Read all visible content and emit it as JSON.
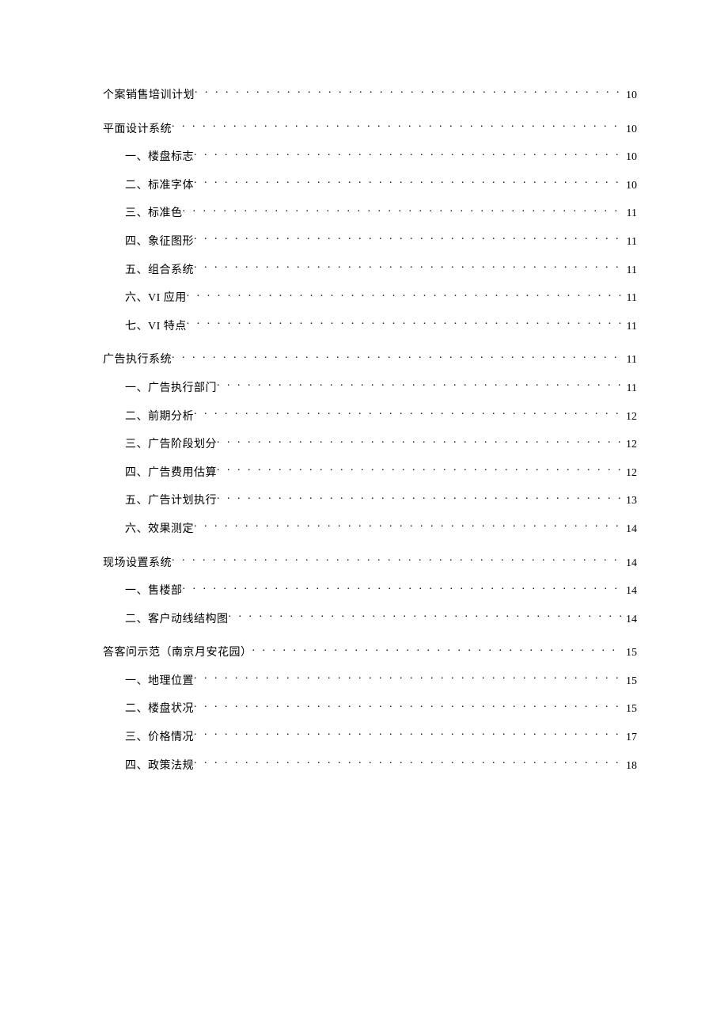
{
  "toc": [
    {
      "level": "section",
      "title": "个案销售培训计划",
      "page": "10"
    },
    {
      "level": "section",
      "title": "平面设计系统",
      "page": "10"
    },
    {
      "level": "sub",
      "title": "一、楼盘标志",
      "page": "10"
    },
    {
      "level": "sub",
      "title": "二、标准字体",
      "page": "10"
    },
    {
      "level": "sub",
      "title": "三、标准色",
      "page": "11"
    },
    {
      "level": "sub",
      "title": "四、象征图形",
      "page": "11"
    },
    {
      "level": "sub",
      "title": "五、组合系统",
      "page": "11"
    },
    {
      "level": "sub",
      "title": "六、VI 应用",
      "page": "11"
    },
    {
      "level": "sub",
      "title": "七、VI 特点",
      "page": "11"
    },
    {
      "level": "section",
      "title": "广告执行系统",
      "page": "11"
    },
    {
      "level": "sub",
      "title": "一、广告执行部门",
      "page": "11"
    },
    {
      "level": "sub",
      "title": "二、前期分析",
      "page": "12"
    },
    {
      "level": "sub",
      "title": "三、广告阶段划分",
      "page": "12"
    },
    {
      "level": "sub",
      "title": "四、广告费用估算",
      "page": "12"
    },
    {
      "level": "sub",
      "title": "五、广告计划执行",
      "page": "13"
    },
    {
      "level": "sub",
      "title": "六、效果测定",
      "page": "14"
    },
    {
      "level": "section",
      "title": "现场设置系统",
      "page": "14"
    },
    {
      "level": "sub",
      "title": "一、售楼部",
      "page": "14"
    },
    {
      "level": "sub",
      "title": "二、客户动线结构图",
      "page": "14"
    },
    {
      "level": "section",
      "title": "答客问示范（南京月安花园）",
      "page": "15"
    },
    {
      "level": "sub",
      "title": "一、地理位置",
      "page": "15"
    },
    {
      "level": "sub",
      "title": "二、楼盘状况",
      "page": "15"
    },
    {
      "level": "sub",
      "title": "三、价格情况",
      "page": "17"
    },
    {
      "level": "sub",
      "title": "四、政策法规",
      "page": "18"
    }
  ]
}
